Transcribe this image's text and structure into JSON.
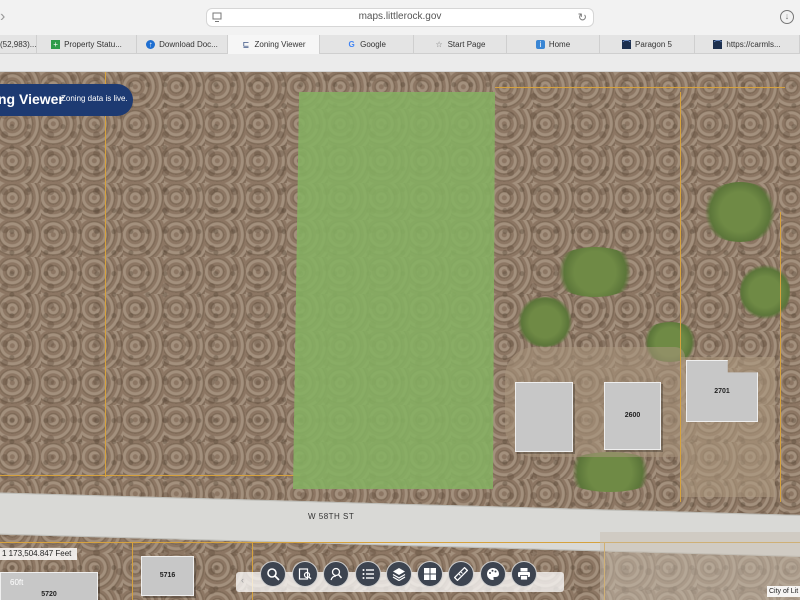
{
  "browser": {
    "url": "maps.littlerock.gov",
    "tabs": [
      {
        "label": "(52,983)...",
        "icon": "blank-icon"
      },
      {
        "label": "Property Statu...",
        "icon": "spreadsheet-icon"
      },
      {
        "label": "Download Doc...",
        "icon": "cloud-icon"
      },
      {
        "label": "Zoning Viewer",
        "icon": "map-search-icon",
        "active": true
      },
      {
        "label": "Google",
        "icon": "google-icon"
      },
      {
        "label": "Start Page",
        "icon": "star-icon"
      },
      {
        "label": "Home",
        "icon": "info-icon"
      },
      {
        "label": "Paragon 5",
        "icon": "chart-icon"
      },
      {
        "label": "https://carmls...",
        "icon": "chart-icon"
      }
    ]
  },
  "app": {
    "title": "ng Viewer",
    "status": "Zoning data is live."
  },
  "map": {
    "street_label": "W 58TH ST",
    "buildings": [
      {
        "label": "2600"
      },
      {
        "label": "2701"
      },
      {
        "label": "5716"
      },
      {
        "label": "5720"
      }
    ],
    "measurement": "1 173,504.847 Feet",
    "scale_label": "60ft",
    "credit": "City of Lit"
  },
  "toolbar": {
    "tools": [
      "search-tool",
      "identify-tool",
      "find-tool",
      "legend-tool",
      "layers-tool",
      "basemap-tool",
      "measure-tool",
      "symbology-tool",
      "print-tool"
    ]
  }
}
